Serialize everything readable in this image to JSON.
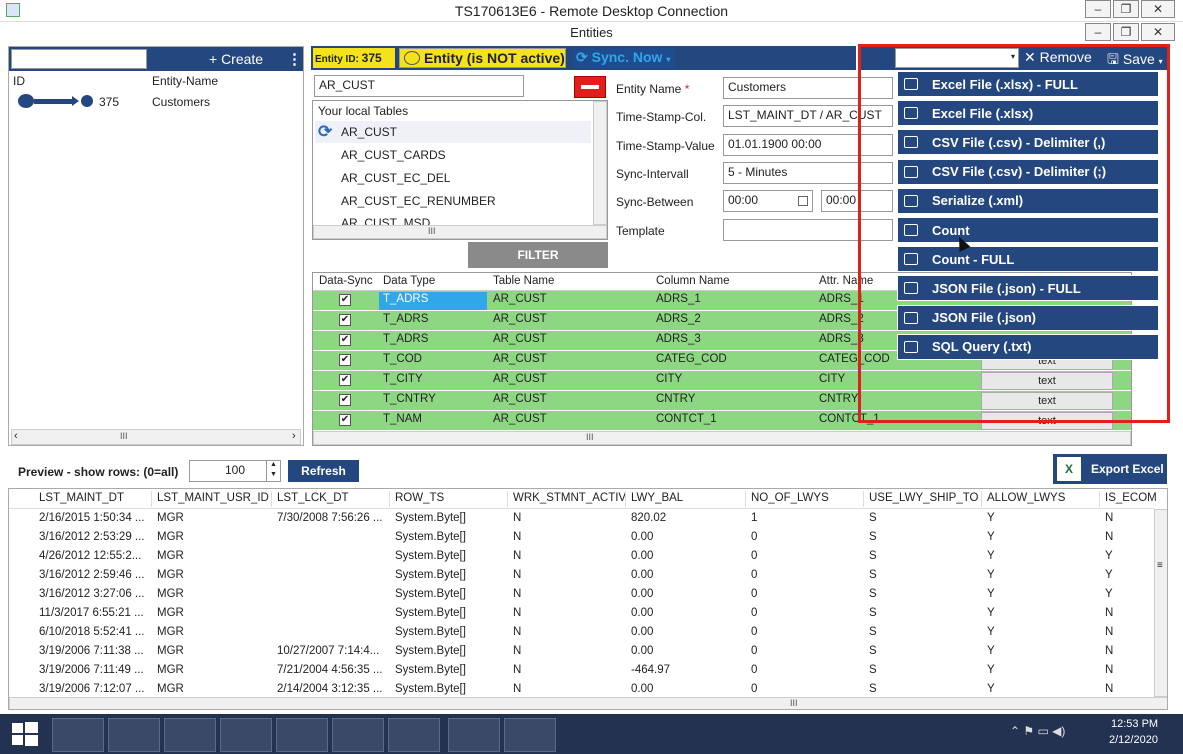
{
  "window": {
    "title": "TS170613E6 - Remote Desktop Connection",
    "subtitle": "Entities",
    "min": "–",
    "restore": "❐",
    "close": "✕"
  },
  "left_panel": {
    "create_label": "+ Create",
    "more": "⋮",
    "columns": {
      "id": "ID",
      "name": "Entity-Name"
    },
    "rows": [
      {
        "id": "375",
        "name": "Customers"
      }
    ],
    "hscroll": "III"
  },
  "entity_bar": {
    "entity_id_label": "Entity ID:",
    "entity_id": "375",
    "entity_status": "Entity (is NOT active)",
    "sync_now": "Sync. Now"
  },
  "table_picker": {
    "search_value": "AR_CUST",
    "list_header": "Your local Tables",
    "items": [
      "AR_CUST",
      "AR_CUST_CARDS",
      "AR_CUST_EC_DEL",
      "AR_CUST_EC_RENUMBER",
      "AR_CUST_MSD"
    ],
    "hscroll": "III",
    "filter_label": "FILTER"
  },
  "form": {
    "entity_name_label": "Entity Name",
    "required_mark": "*",
    "entity_name_value": "Customers",
    "timestamp_col_label": "Time-Stamp-Col.",
    "timestamp_col_value": "LST_MAINT_DT / AR_CUST",
    "timestamp_value_label": "Time-Stamp-Value",
    "timestamp_value": "01.01.1900 00:00",
    "sync_interval_label": "Sync-Intervall",
    "sync_interval_value": "5 - Minutes",
    "sync_between_label": "Sync-Between",
    "sync_between_from": "00:00",
    "sync_between_to": "00:00",
    "template_label": "Template",
    "template_value": ""
  },
  "mapping_grid": {
    "columns": [
      "Data-Sync",
      "Data Type",
      "Table Name",
      "Column Name",
      "Attr. Name"
    ],
    "rows": [
      {
        "sync": "✔",
        "type": "T_ADRS",
        "table": "AR_CUST",
        "column": "ADRS_1",
        "attr": "ADRS_1",
        "extra": ""
      },
      {
        "sync": "✔",
        "type": "T_ADRS",
        "table": "AR_CUST",
        "column": "ADRS_2",
        "attr": "ADRS_2",
        "extra": ""
      },
      {
        "sync": "✔",
        "type": "T_ADRS",
        "table": "AR_CUST",
        "column": "ADRS_3",
        "attr": "ADRS_3",
        "extra": ""
      },
      {
        "sync": "✔",
        "type": "T_COD",
        "table": "AR_CUST",
        "column": "CATEG_COD",
        "attr": "CATEG_COD",
        "extra": "text"
      },
      {
        "sync": "✔",
        "type": "T_CITY",
        "table": "AR_CUST",
        "column": "CITY",
        "attr": "CITY",
        "extra": "text"
      },
      {
        "sync": "✔",
        "type": "T_CNTRY",
        "table": "AR_CUST",
        "column": "CNTRY",
        "attr": "CNTRY",
        "extra": "text"
      },
      {
        "sync": "✔",
        "type": "T_NAM",
        "table": "AR_CUST",
        "column": "CONTCT_1",
        "attr": "CONTCT_1",
        "extra": "text"
      }
    ],
    "hscroll": "III"
  },
  "toolbar_right": {
    "remove_label": "Remove",
    "save_label": "Save"
  },
  "export_menu": {
    "items": [
      "Excel File (.xlsx) - FULL",
      "Excel File (.xlsx)",
      "CSV File (.csv) - Delimiter (,)",
      "CSV File (.csv) - Delimiter (;)",
      "Serialize (.xml)",
      "Count",
      "Count - FULL",
      "JSON File (.json) - FULL",
      "JSON File (.json)",
      "SQL Query (.txt)"
    ],
    "highlight_color": "#e0201b",
    "item_color": "#24477f"
  },
  "preview": {
    "label": "Preview - show rows: (0=all)",
    "rows_value": "100",
    "refresh_label": "Refresh",
    "export_excel_label": "Export Excel",
    "columns": [
      "LST_MAINT_DT",
      "LST_MAINT_USR_ID",
      "LST_LCK_DT",
      "ROW_TS",
      "WRK_STMNT_ACTIV",
      "LWY_BAL",
      "NO_OF_LWYS",
      "USE_LWY_SHIP_TO",
      "ALLOW_LWYS",
      "IS_ECOM"
    ],
    "rows": [
      [
        "2/16/2015 1:50:34 ...",
        "MGR",
        "7/30/2008 7:56:26 ...",
        "System.Byte[]",
        "N",
        "820.02",
        "1",
        "S",
        "Y",
        "N"
      ],
      [
        "3/16/2012 2:53:29 ...",
        "MGR",
        "",
        "System.Byte[]",
        "N",
        "0.00",
        "0",
        "S",
        "Y",
        "N"
      ],
      [
        "4/26/2012 12:55:2...",
        "MGR",
        "",
        "System.Byte[]",
        "N",
        "0.00",
        "0",
        "S",
        "Y",
        "Y"
      ],
      [
        "3/16/2012 2:59:46 ...",
        "MGR",
        "",
        "System.Byte[]",
        "N",
        "0.00",
        "0",
        "S",
        "Y",
        "Y"
      ],
      [
        "3/16/2012 3:27:06 ...",
        "MGR",
        "",
        "System.Byte[]",
        "N",
        "0.00",
        "0",
        "S",
        "Y",
        "Y"
      ],
      [
        "11/3/2017 6:55:21 ...",
        "MGR",
        "",
        "System.Byte[]",
        "N",
        "0.00",
        "0",
        "S",
        "Y",
        "N"
      ],
      [
        "6/10/2018 5:52:41 ...",
        "MGR",
        "",
        "System.Byte[]",
        "N",
        "0.00",
        "0",
        "S",
        "Y",
        "N"
      ],
      [
        "3/19/2006 7:11:38 ...",
        "MGR",
        "10/27/2007 7:14:4...",
        "System.Byte[]",
        "N",
        "0.00",
        "0",
        "S",
        "Y",
        "N"
      ],
      [
        "3/19/2006 7:11:49 ...",
        "MGR",
        "7/21/2004 4:56:35 ...",
        "System.Byte[]",
        "N",
        "-464.97",
        "0",
        "S",
        "Y",
        "N"
      ],
      [
        "3/19/2006 7:12:07 ...",
        "MGR",
        "2/14/2004 3:12:35 ...",
        "System.Byte[]",
        "N",
        "0.00",
        "0",
        "S",
        "Y",
        "N"
      ]
    ],
    "hscroll": "III"
  },
  "taskbar": {
    "time": "12:53 PM",
    "date": "2/12/2020"
  }
}
